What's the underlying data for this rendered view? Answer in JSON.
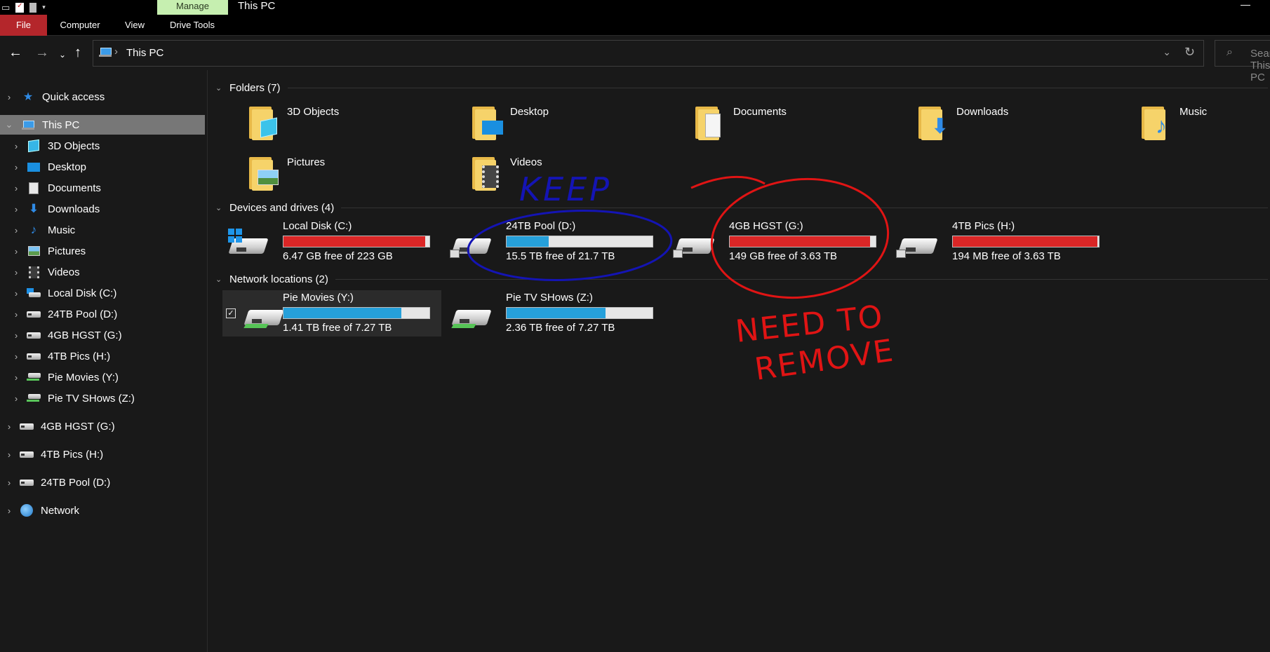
{
  "window": {
    "title": "This PC",
    "context_tab": "Manage"
  },
  "ribbon": {
    "tabs": [
      "File",
      "Computer",
      "View",
      "Drive Tools"
    ]
  },
  "address": {
    "path": "This PC",
    "search_placeholder": "Search This PC"
  },
  "sidebar": {
    "items": [
      {
        "label": "Quick access",
        "icon": "star-icon"
      },
      {
        "label": "This PC",
        "icon": "computer-icon"
      },
      {
        "label": "3D Objects",
        "icon": "cube-icon"
      },
      {
        "label": "Desktop",
        "icon": "desktop-icon"
      },
      {
        "label": "Documents",
        "icon": "document-icon"
      },
      {
        "label": "Downloads",
        "icon": "download-icon"
      },
      {
        "label": "Music",
        "icon": "music-icon"
      },
      {
        "label": "Pictures",
        "icon": "pictures-icon"
      },
      {
        "label": "Videos",
        "icon": "videos-icon"
      },
      {
        "label": "Local Disk (C:)",
        "icon": "system-drive-icon"
      },
      {
        "label": "24TB Pool (D:)",
        "icon": "drive-icon"
      },
      {
        "label": "4GB HGST (G:)",
        "icon": "drive-icon"
      },
      {
        "label": "4TB Pics (H:)",
        "icon": "drive-icon"
      },
      {
        "label": "Pie Movies (Y:)",
        "icon": "network-drive-icon"
      },
      {
        "label": "Pie TV SHows (Z:)",
        "icon": "network-drive-icon"
      },
      {
        "label": "4GB HGST (G:)",
        "icon": "drive-icon"
      },
      {
        "label": "4TB Pics (H:)",
        "icon": "drive-icon"
      },
      {
        "label": "24TB Pool (D:)",
        "icon": "drive-icon"
      },
      {
        "label": "Network",
        "icon": "network-icon"
      }
    ]
  },
  "groups": {
    "folders": "Folders (7)",
    "drives": "Devices and drives (4)",
    "network": "Network locations (2)"
  },
  "folders": [
    "3D Objects",
    "Desktop",
    "Documents",
    "Downloads",
    "Music",
    "Pictures",
    "Videos"
  ],
  "drives": [
    {
      "name": "Local Disk (C:)",
      "free": "6.47 GB free of 223 GB",
      "used_fraction": 0.97,
      "bar_color": "#da2626"
    },
    {
      "name": "24TB Pool (D:)",
      "free": "15.5 TB free of 21.7 TB",
      "used_fraction": 0.29,
      "bar_color": "#26a0da"
    },
    {
      "name": "4GB HGST (G:)",
      "free": "149 GB free of 3.63 TB",
      "used_fraction": 0.96,
      "bar_color": "#da2626"
    },
    {
      "name": "4TB Pics (H:)",
      "free": "194 MB free of 3.63 TB",
      "used_fraction": 0.99,
      "bar_color": "#da2626"
    }
  ],
  "network_locations": [
    {
      "name": "Pie Movies (Y:)",
      "free": "1.41 TB free of 7.27 TB",
      "used_fraction": 0.81,
      "bar_color": "#26a0da"
    },
    {
      "name": "Pie TV SHows (Z:)",
      "free": "2.36 TB free of 7.27 TB",
      "used_fraction": 0.68,
      "bar_color": "#26a0da"
    }
  ],
  "annotations": {
    "keep": "KEEP",
    "remove_line1": "NEED TO",
    "remove_line2": "REMOVE"
  }
}
